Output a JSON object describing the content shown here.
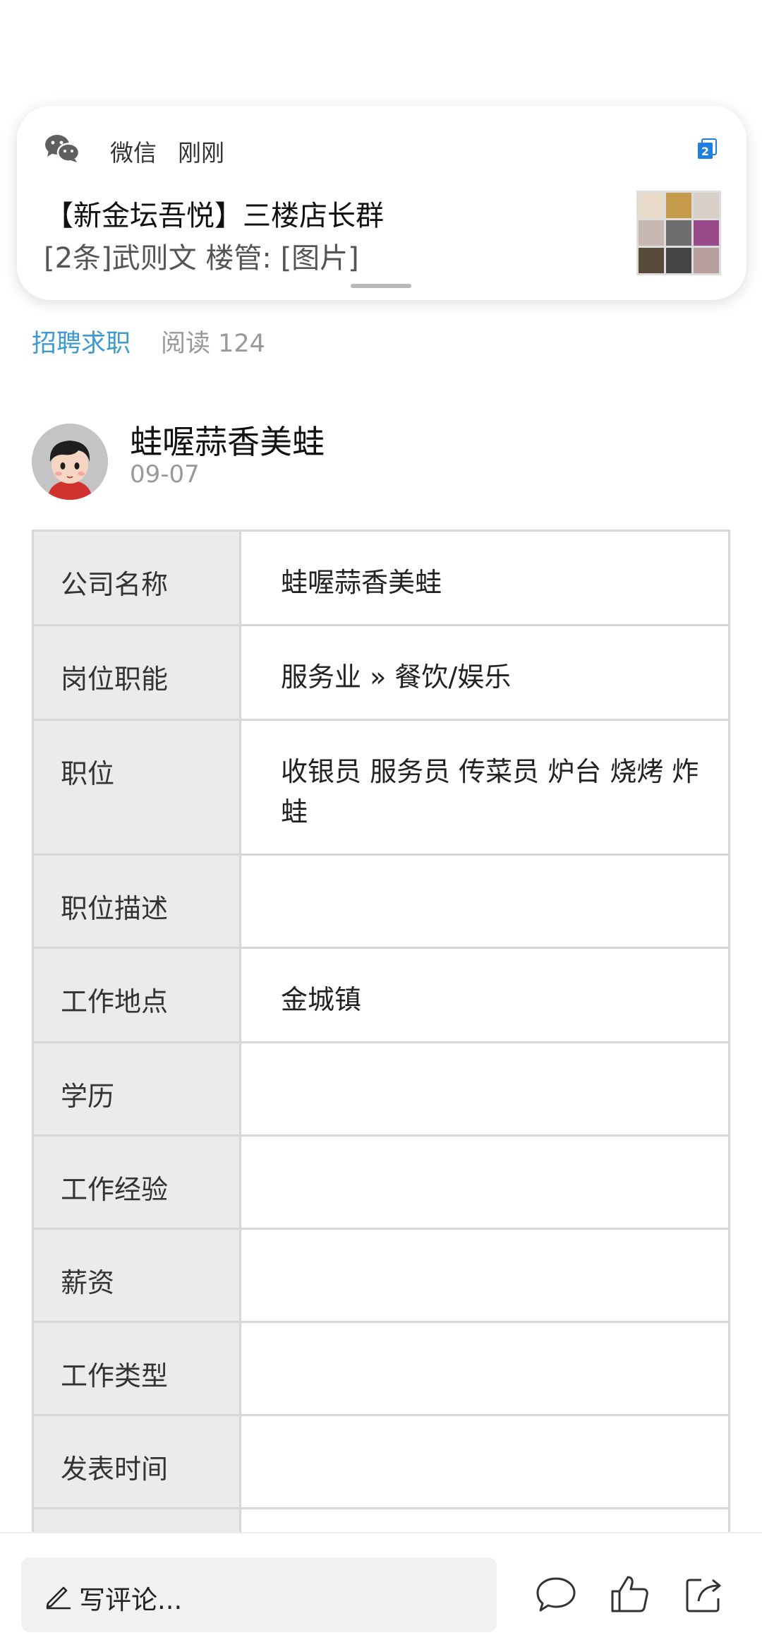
{
  "notification": {
    "app_name": "微信",
    "time": "刚刚",
    "title": "【新金坛吾悦】三楼店长群",
    "body": "[2条]武则文  楼管: [图片]",
    "thumb_colors": [
      "#e8d9c8",
      "#c59a4a",
      "#d7cfc6",
      "#c9b7b2",
      "#6e6e6e",
      "#9a4a8a",
      "#5a4a3a",
      "#444444",
      "#b9a0a0"
    ]
  },
  "article": {
    "category": "招聘求职",
    "reads": "阅读 124"
  },
  "author": {
    "name": "蛙喔蒜香美蛙",
    "date": "09-07"
  },
  "info_table": {
    "rows": [
      {
        "key": "公司名称",
        "value": "蛙喔蒜香美蛙"
      },
      {
        "key": "岗位职能",
        "value": "服务业 » 餐饮/娱乐"
      },
      {
        "key": "职位",
        "value": "收银员 服务员 传菜员 炉台 烧烤 炸蛙"
      },
      {
        "key": "职位描述",
        "value": ""
      },
      {
        "key": "工作地点",
        "value": "金城镇"
      },
      {
        "key": "学历",
        "value": ""
      },
      {
        "key": "工作经验",
        "value": ""
      },
      {
        "key": "薪资",
        "value": ""
      },
      {
        "key": "工作类型",
        "value": ""
      },
      {
        "key": "发表时间",
        "value": ""
      },
      {
        "key": "",
        "value": ""
      }
    ]
  },
  "bottom_bar": {
    "comment_placeholder": "写评论..."
  },
  "icons": {
    "wechat": "wechat-icon",
    "badge": "notification-count-icon",
    "pencil": "pencil-icon",
    "comment": "comment-icon",
    "like": "thumbs-up-icon",
    "share": "share-icon"
  },
  "colors": {
    "accent": "#3d9ad1",
    "badge": "#1e7fe0"
  }
}
